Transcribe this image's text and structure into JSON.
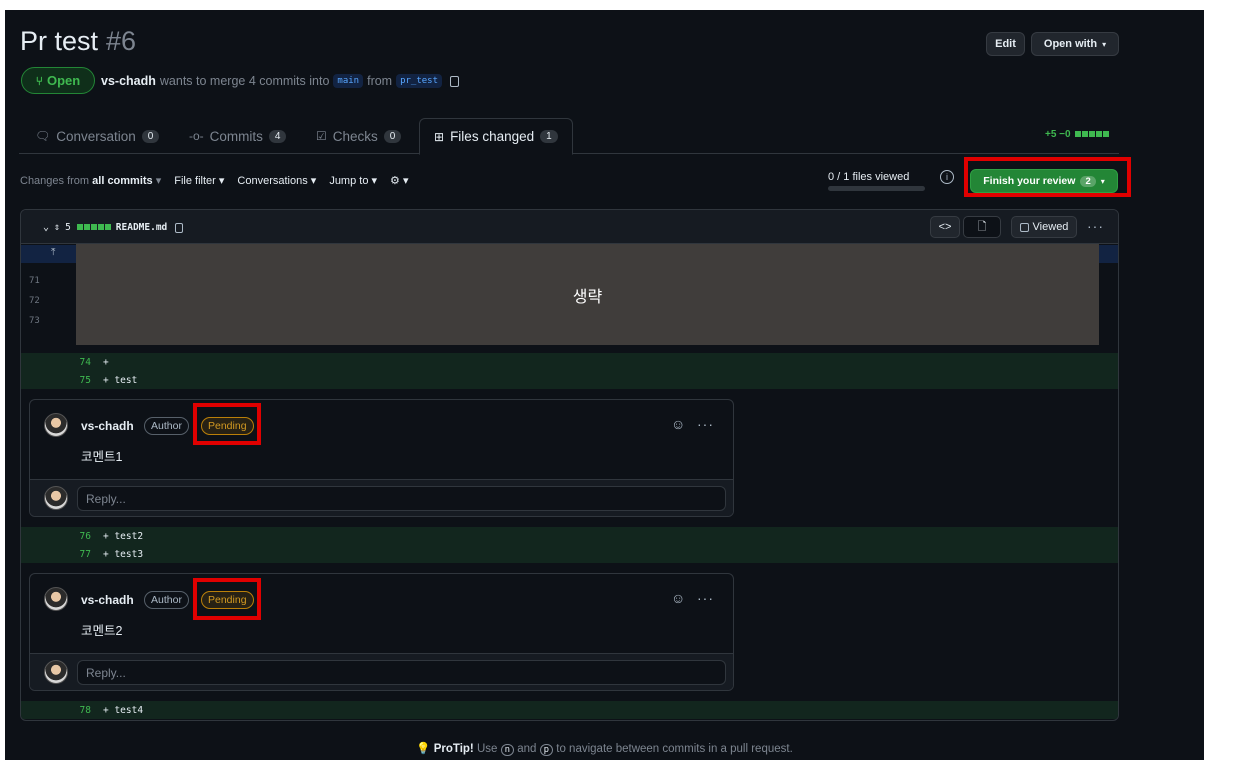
{
  "pr": {
    "title": "Pr test",
    "number": "#6",
    "state": "Open",
    "author": "vs-chadh",
    "merge_text": "wants to merge 4 commits into",
    "base_branch": "main",
    "from_text": "from",
    "head_branch": "pr_test"
  },
  "header_buttons": {
    "edit": "Edit",
    "open_with": "Open with"
  },
  "tabs": [
    {
      "label": "Conversation",
      "count": "0"
    },
    {
      "label": "Commits",
      "count": "4"
    },
    {
      "label": "Checks",
      "count": "0"
    },
    {
      "label": "Files changed",
      "count": "1"
    }
  ],
  "diffstat": {
    "text": "+5 −0",
    "add_color": "#3fb950"
  },
  "toolbar": {
    "changes_prefix": "Changes from",
    "changes_value": "all commits",
    "file_filter": "File filter",
    "conversations": "Conversations",
    "jump_to": "Jump to",
    "files_viewed": "0 / 1 files viewed",
    "finish_review": "Finish your review",
    "finish_count": "2"
  },
  "file": {
    "count": "5",
    "name": "README.md",
    "viewed_label": "Viewed",
    "context_lines": [
      "71",
      "72",
      "73"
    ],
    "omitted_label": "생략"
  },
  "lines": {
    "l74": {
      "num": "74",
      "code": "+"
    },
    "l75": {
      "num": "75",
      "code": "+ test"
    },
    "l76": {
      "num": "76",
      "code": "+ test2"
    },
    "l77": {
      "num": "77",
      "code": "+ test3"
    },
    "l78": {
      "num": "78",
      "code": "+ test4"
    }
  },
  "comments": [
    {
      "author": "vs-chadh",
      "role": "Author",
      "status": "Pending",
      "body": "코멘트1",
      "reply_placeholder": "Reply..."
    },
    {
      "author": "vs-chadh",
      "role": "Author",
      "status": "Pending",
      "body": "코멘트2",
      "reply_placeholder": "Reply..."
    }
  ],
  "protip": {
    "label": "ProTip!",
    "use": "Use",
    "key_n": "n",
    "and": "and",
    "key_p": "p",
    "rest": "to navigate between commits in a pull request."
  },
  "colors": {
    "highlight": "#e00000",
    "accent_green": "#238636",
    "pending": "#d29922"
  }
}
